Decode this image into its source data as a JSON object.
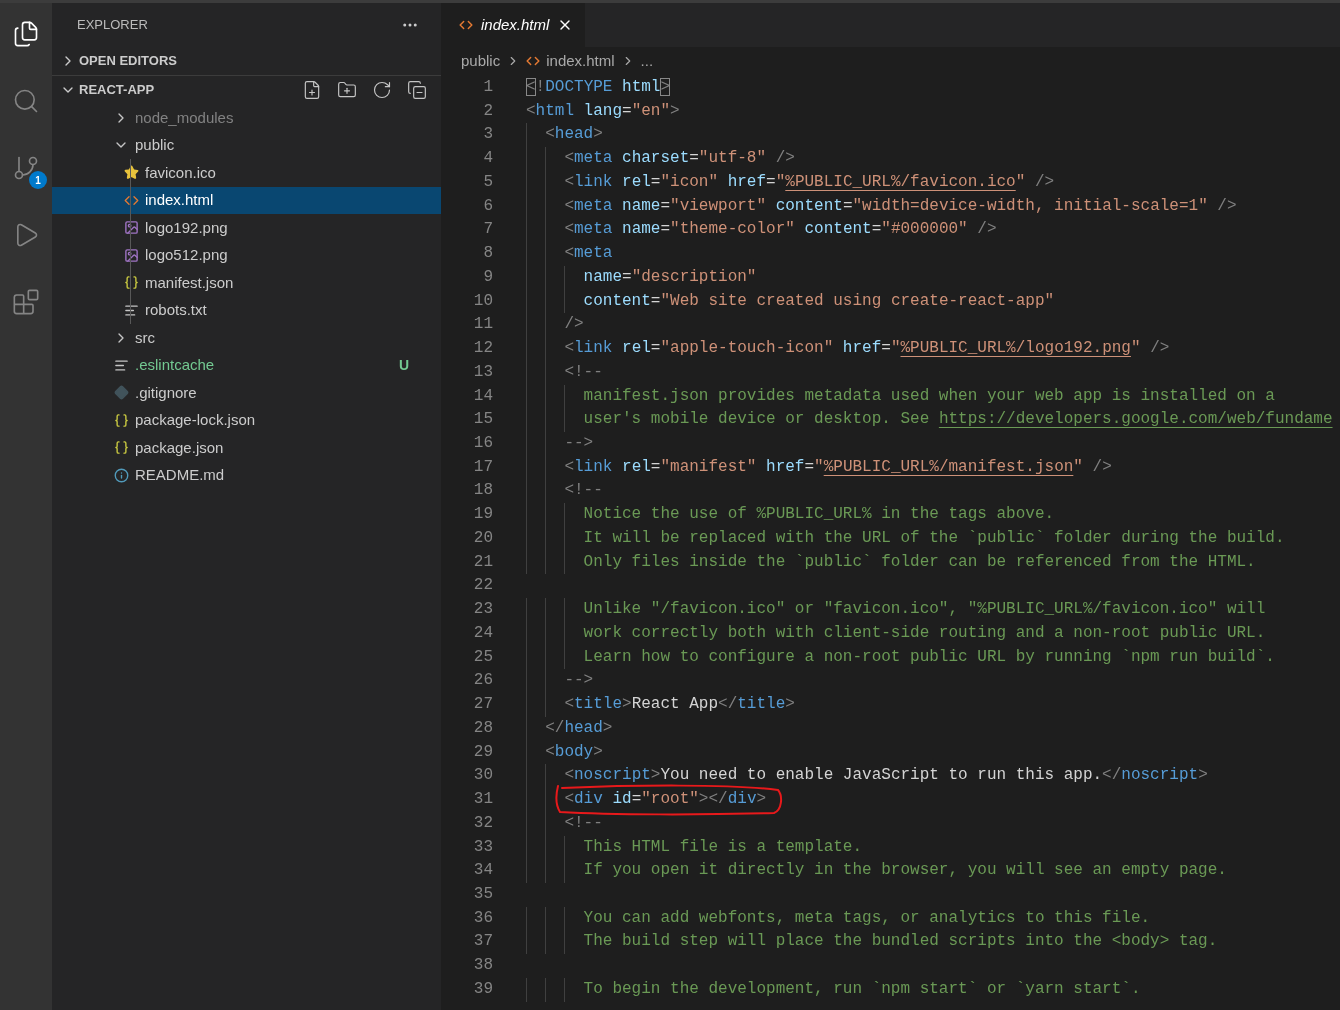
{
  "activity_bar": [
    {
      "kind": "files",
      "selected": true
    },
    {
      "kind": "search",
      "selected": false
    },
    {
      "kind": "source_control",
      "selected": false,
      "badge": "1"
    },
    {
      "kind": "run",
      "selected": false
    },
    {
      "kind": "extensions",
      "selected": false
    }
  ],
  "explorer": {
    "title": "EXPLORER",
    "sections": [
      {
        "label": "OPEN EDITORS",
        "expanded": false
      },
      {
        "label": "REACT-APP",
        "expanded": true,
        "items": [
          {
            "name": "node_modules",
            "kind": "folder",
            "expanded": false,
            "selected": false,
            "ignored": true,
            "untracked": false
          },
          {
            "name": "public",
            "kind": "folder",
            "expanded": true,
            "selected": false,
            "ignored": false,
            "untracked": false,
            "children": [
              {
                "name": "favicon.ico",
                "kind": "favicon",
                "selected": false,
                "ignored": false,
                "untracked": false
              },
              {
                "name": "index.html",
                "kind": "html",
                "selected": true,
                "ignored": false,
                "untracked": false
              },
              {
                "name": "logo192.png",
                "kind": "image",
                "selected": false,
                "ignored": false,
                "untracked": false
              },
              {
                "name": "logo512.png",
                "kind": "image",
                "selected": false,
                "ignored": false,
                "untracked": false
              },
              {
                "name": "manifest.json",
                "kind": "json",
                "selected": false,
                "ignored": false,
                "untracked": false
              },
              {
                "name": "robots.txt",
                "kind": "text",
                "selected": false,
                "ignored": false,
                "untracked": false
              }
            ]
          },
          {
            "name": "src",
            "kind": "folder",
            "expanded": false,
            "selected": false,
            "ignored": false,
            "untracked": false
          },
          {
            "name": ".eslintcache",
            "kind": "text",
            "selected": false,
            "ignored": false,
            "untracked": true,
            "status": "U"
          },
          {
            "name": ".gitignore",
            "kind": "git",
            "selected": false,
            "ignored": false,
            "untracked": false
          },
          {
            "name": "package-lock.json",
            "kind": "json",
            "selected": false,
            "ignored": false,
            "untracked": false
          },
          {
            "name": "package.json",
            "kind": "json",
            "selected": false,
            "ignored": false,
            "untracked": false
          },
          {
            "name": "README.md",
            "kind": "info",
            "selected": false,
            "ignored": false,
            "untracked": false
          }
        ]
      }
    ]
  },
  "tabs": [
    {
      "label": "index.html",
      "selected": true
    }
  ],
  "breadcrumbs": [
    "public",
    "index.html",
    "..."
  ],
  "code_lines": [
    {
      "num": "1",
      "tokens": [
        {
          "kind": "match",
          "text": "<"
        },
        {
          "kind": "punct",
          "text": "!"
        },
        {
          "kind": "tag",
          "text": "DOCTYPE"
        },
        {
          "kind": "attr",
          "text": " html"
        },
        {
          "kind": "match",
          "text": ">"
        }
      ]
    },
    {
      "num": "2",
      "tokens": [
        {
          "kind": "punct",
          "text": "<"
        },
        {
          "kind": "tag",
          "text": "html"
        },
        {
          "kind": "attr",
          "text": " lang"
        },
        {
          "kind": "text",
          "text": "="
        },
        {
          "kind": "string",
          "text": "\"en\""
        },
        {
          "kind": "punct",
          "text": ">"
        }
      ]
    },
    {
      "num": "3",
      "tokens": [
        {
          "kind": "punct",
          "text": "  <"
        },
        {
          "kind": "tag",
          "text": "head"
        },
        {
          "kind": "punct",
          "text": ">"
        }
      ]
    },
    {
      "num": "4",
      "tokens": [
        {
          "kind": "punct",
          "text": "    <"
        },
        {
          "kind": "tag",
          "text": "meta"
        },
        {
          "kind": "attr",
          "text": " charset"
        },
        {
          "kind": "text",
          "text": "="
        },
        {
          "kind": "string",
          "text": "\"utf-8\""
        },
        {
          "kind": "punct",
          "text": " />"
        }
      ]
    },
    {
      "num": "5",
      "tokens": [
        {
          "kind": "punct",
          "text": "    <"
        },
        {
          "kind": "tag",
          "text": "link"
        },
        {
          "kind": "attr",
          "text": " rel"
        },
        {
          "kind": "text",
          "text": "="
        },
        {
          "kind": "string",
          "text": "\"icon\""
        },
        {
          "kind": "attr",
          "text": " href"
        },
        {
          "kind": "text",
          "text": "="
        },
        {
          "kind": "string",
          "text": "\""
        },
        {
          "kind": "string_link",
          "text": "%PUBLIC_URL%/favicon.ico"
        },
        {
          "kind": "string",
          "text": "\""
        },
        {
          "kind": "punct",
          "text": " />"
        }
      ]
    },
    {
      "num": "6",
      "tokens": [
        {
          "kind": "punct",
          "text": "    <"
        },
        {
          "kind": "tag",
          "text": "meta"
        },
        {
          "kind": "attr",
          "text": " name"
        },
        {
          "kind": "text",
          "text": "="
        },
        {
          "kind": "string",
          "text": "\"viewport\""
        },
        {
          "kind": "attr",
          "text": " content"
        },
        {
          "kind": "text",
          "text": "="
        },
        {
          "kind": "string",
          "text": "\"width=device-width, initial-scale=1\""
        },
        {
          "kind": "punct",
          "text": " />"
        }
      ]
    },
    {
      "num": "7",
      "tokens": [
        {
          "kind": "punct",
          "text": "    <"
        },
        {
          "kind": "tag",
          "text": "meta"
        },
        {
          "kind": "attr",
          "text": " name"
        },
        {
          "kind": "text",
          "text": "="
        },
        {
          "kind": "string",
          "text": "\"theme-color\""
        },
        {
          "kind": "attr",
          "text": " content"
        },
        {
          "kind": "text",
          "text": "="
        },
        {
          "kind": "string",
          "text": "\"#000000\""
        },
        {
          "kind": "punct",
          "text": " />"
        }
      ]
    },
    {
      "num": "8",
      "tokens": [
        {
          "kind": "punct",
          "text": "    <"
        },
        {
          "kind": "tag",
          "text": "meta"
        }
      ]
    },
    {
      "num": "9",
      "tokens": [
        {
          "kind": "attr",
          "text": "      name"
        },
        {
          "kind": "text",
          "text": "="
        },
        {
          "kind": "string",
          "text": "\"description\""
        }
      ]
    },
    {
      "num": "10",
      "tokens": [
        {
          "kind": "attr",
          "text": "      content"
        },
        {
          "kind": "text",
          "text": "="
        },
        {
          "kind": "string",
          "text": "\"Web site created using create-react-app\""
        }
      ]
    },
    {
      "num": "11",
      "tokens": [
        {
          "kind": "punct",
          "text": "    />"
        }
      ]
    },
    {
      "num": "12",
      "tokens": [
        {
          "kind": "punct",
          "text": "    <"
        },
        {
          "kind": "tag",
          "text": "link"
        },
        {
          "kind": "attr",
          "text": " rel"
        },
        {
          "kind": "text",
          "text": "="
        },
        {
          "kind": "string",
          "text": "\"apple-touch-icon\""
        },
        {
          "kind": "attr",
          "text": " href"
        },
        {
          "kind": "text",
          "text": "="
        },
        {
          "kind": "string",
          "text": "\""
        },
        {
          "kind": "string_link",
          "text": "%PUBLIC_URL%/logo192.png"
        },
        {
          "kind": "string",
          "text": "\""
        },
        {
          "kind": "punct",
          "text": " />"
        }
      ]
    },
    {
      "num": "13",
      "tokens": [
        {
          "kind": "punct",
          "text": "    <!--"
        }
      ]
    },
    {
      "num": "14",
      "tokens": [
        {
          "kind": "comment",
          "text": "      manifest.json provides metadata used when your web app is installed on a"
        }
      ]
    },
    {
      "num": "15",
      "tokens": [
        {
          "kind": "comment",
          "text": "      user's mobile device or desktop. See "
        },
        {
          "kind": "comment_link",
          "text": "https://developers.google.com/web/fundame"
        }
      ]
    },
    {
      "num": "16",
      "tokens": [
        {
          "kind": "punct",
          "text": "    -->"
        }
      ]
    },
    {
      "num": "17",
      "tokens": [
        {
          "kind": "punct",
          "text": "    <"
        },
        {
          "kind": "tag",
          "text": "link"
        },
        {
          "kind": "attr",
          "text": " rel"
        },
        {
          "kind": "text",
          "text": "="
        },
        {
          "kind": "string",
          "text": "\"manifest\""
        },
        {
          "kind": "attr",
          "text": " href"
        },
        {
          "kind": "text",
          "text": "="
        },
        {
          "kind": "string",
          "text": "\""
        },
        {
          "kind": "string_link",
          "text": "%PUBLIC_URL%/manifest.json"
        },
        {
          "kind": "string",
          "text": "\""
        },
        {
          "kind": "punct",
          "text": " />"
        }
      ]
    },
    {
      "num": "18",
      "tokens": [
        {
          "kind": "punct",
          "text": "    <!--"
        }
      ]
    },
    {
      "num": "19",
      "tokens": [
        {
          "kind": "comment",
          "text": "      Notice the use of %PUBLIC_URL% in the tags above."
        }
      ]
    },
    {
      "num": "20",
      "tokens": [
        {
          "kind": "comment",
          "text": "      It will be replaced with the URL of the `public` folder during the build."
        }
      ]
    },
    {
      "num": "21",
      "tokens": [
        {
          "kind": "comment",
          "text": "      Only files inside the `public` folder can be referenced from the HTML."
        }
      ]
    },
    {
      "num": "22"
    },
    {
      "num": "23",
      "tokens": [
        {
          "kind": "comment",
          "text": "      Unlike \"/favicon.ico\" or \"favicon.ico\", \"%PUBLIC_URL%/favicon.ico\" will"
        }
      ]
    },
    {
      "num": "24",
      "tokens": [
        {
          "kind": "comment",
          "text": "      work correctly both with client-side routing and a non-root public URL."
        }
      ]
    },
    {
      "num": "25",
      "tokens": [
        {
          "kind": "comment",
          "text": "      Learn how to configure a non-root public URL by running `npm run build`."
        }
      ]
    },
    {
      "num": "26",
      "tokens": [
        {
          "kind": "punct",
          "text": "    -->"
        }
      ]
    },
    {
      "num": "27",
      "tokens": [
        {
          "kind": "punct",
          "text": "    <"
        },
        {
          "kind": "tag",
          "text": "title"
        },
        {
          "kind": "punct",
          "text": ">"
        },
        {
          "kind": "text",
          "text": "React App"
        },
        {
          "kind": "punct",
          "text": "</"
        },
        {
          "kind": "tag",
          "text": "title"
        },
        {
          "kind": "punct",
          "text": ">"
        }
      ]
    },
    {
      "num": "28",
      "tokens": [
        {
          "kind": "punct",
          "text": "  </"
        },
        {
          "kind": "tag",
          "text": "head"
        },
        {
          "kind": "punct",
          "text": ">"
        }
      ]
    },
    {
      "num": "29",
      "tokens": [
        {
          "kind": "punct",
          "text": "  <"
        },
        {
          "kind": "tag",
          "text": "body"
        },
        {
          "kind": "punct",
          "text": ">"
        }
      ]
    },
    {
      "num": "30",
      "tokens": [
        {
          "kind": "punct",
          "text": "    <"
        },
        {
          "kind": "tag",
          "text": "noscript"
        },
        {
          "kind": "punct",
          "text": ">"
        },
        {
          "kind": "text",
          "text": "You need to enable JavaScript to run this app."
        },
        {
          "kind": "punct",
          "text": "</"
        },
        {
          "kind": "tag",
          "text": "noscript"
        },
        {
          "kind": "punct",
          "text": ">"
        }
      ]
    },
    {
      "num": "31",
      "annotated": true,
      "tokens": [
        {
          "kind": "punct",
          "text": "    <"
        },
        {
          "kind": "tag",
          "text": "div"
        },
        {
          "kind": "attr",
          "text": " id"
        },
        {
          "kind": "text",
          "text": "="
        },
        {
          "kind": "string",
          "text": "\"root\""
        },
        {
          "kind": "punct",
          "text": "></"
        },
        {
          "kind": "tag",
          "text": "div"
        },
        {
          "kind": "punct",
          "text": ">"
        }
      ]
    },
    {
      "num": "32",
      "tokens": [
        {
          "kind": "punct",
          "text": "    <!--"
        }
      ]
    },
    {
      "num": "33",
      "tokens": [
        {
          "kind": "comment",
          "text": "      This HTML file is a template."
        }
      ]
    },
    {
      "num": "34",
      "tokens": [
        {
          "kind": "comment",
          "text": "      If you open it directly in the browser, you will see an empty page."
        }
      ]
    },
    {
      "num": "35"
    },
    {
      "num": "36",
      "tokens": [
        {
          "kind": "comment",
          "text": "      You can add webfonts, meta tags, or analytics to this file."
        }
      ]
    },
    {
      "num": "37",
      "tokens": [
        {
          "kind": "comment",
          "text": "      The build step will place the bundled scripts into the <body> tag."
        }
      ]
    },
    {
      "num": "38"
    },
    {
      "num": "39",
      "tokens": [
        {
          "kind": "comment",
          "text": "      To begin the development, run `npm start` or `yarn start`."
        }
      ]
    }
  ]
}
